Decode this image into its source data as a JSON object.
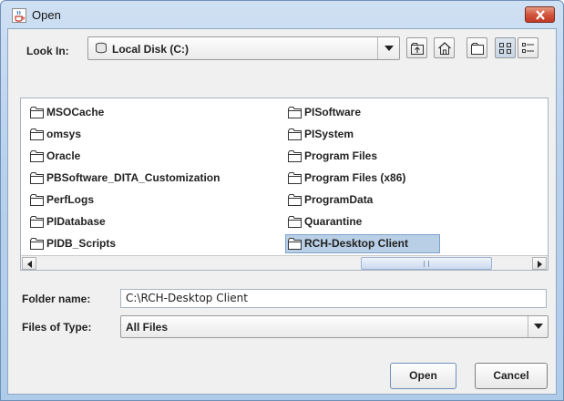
{
  "window": {
    "title": "Open",
    "title_icon": "java-cup-icon",
    "close_icon": "close-icon"
  },
  "look_in": {
    "label": "Look In:",
    "value": "Local Disk (C:)",
    "icon": "disk-icon"
  },
  "toolbar": {
    "buttons": [
      "up-one-level-icon",
      "home-icon",
      "new-folder-icon",
      "list-view-icon",
      "details-view-icon"
    ],
    "active": "list-view-icon"
  },
  "files": {
    "column1": [
      "MSOCache",
      "omsys",
      "Oracle",
      "PBSoftware_DITA_Customization",
      "PerfLogs",
      "PIDatabase",
      "PIDB_Scripts"
    ],
    "column2": [
      "PISoftware",
      "PISystem",
      "Program Files",
      "Program Files (x86)",
      "ProgramData",
      "Quarantine",
      "RCH-Desktop Client"
    ],
    "selected": "RCH-Desktop Client"
  },
  "folder_name": {
    "label": "Folder name:",
    "value": "C:\\RCH-Desktop Client"
  },
  "files_of_type": {
    "label": "Files of Type:",
    "value": "All Files"
  },
  "buttons": {
    "open": "Open",
    "cancel": "Cancel"
  },
  "colors": {
    "selection": "#b8cfe5",
    "title_gradient": "#b9d1ec",
    "close_button": "#c23a24"
  }
}
